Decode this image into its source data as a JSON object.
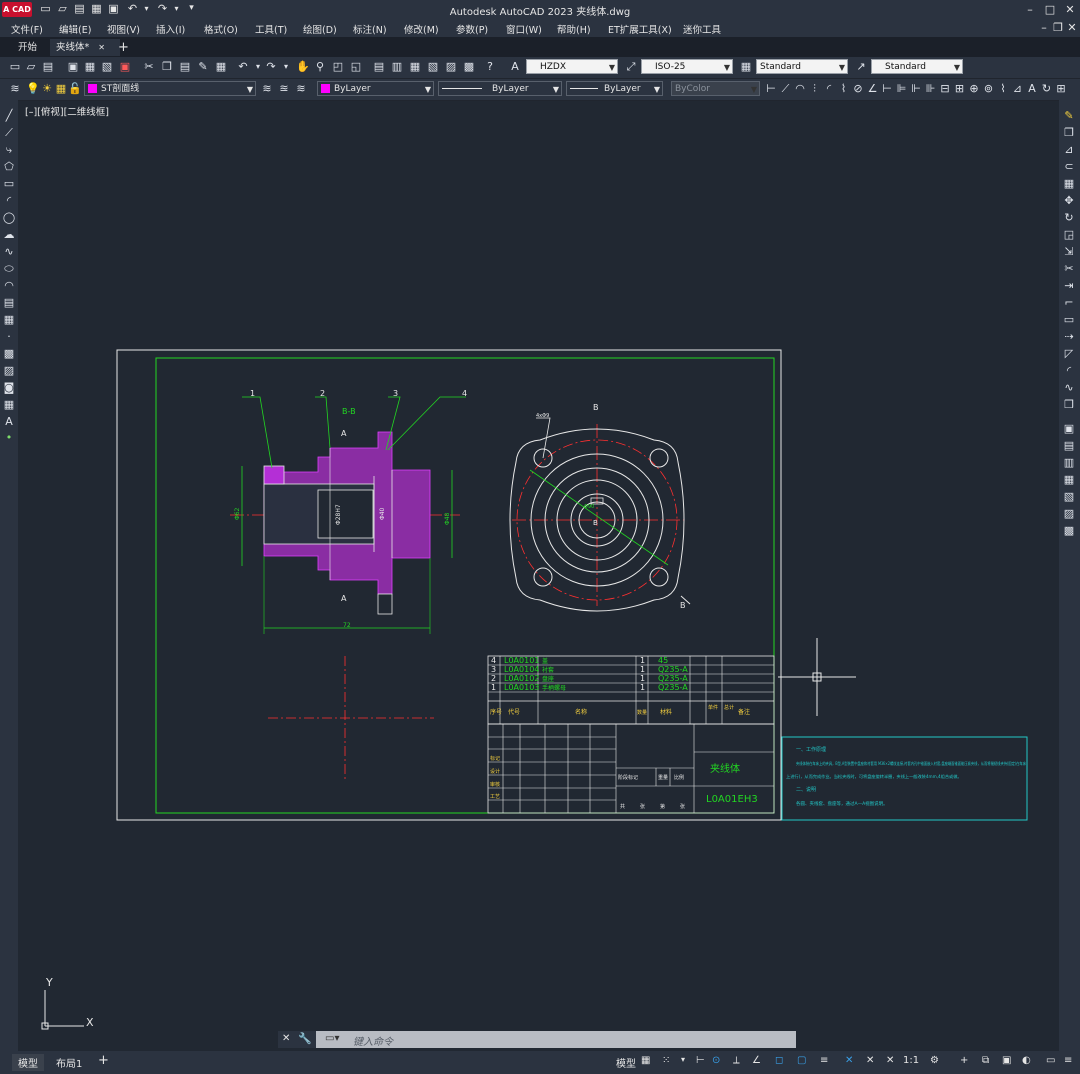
{
  "app": {
    "logo": "A CAD",
    "title": "Autodesk AutoCAD 2023    夹线体.dwg",
    "window_buttons": [
      "–",
      "□",
      "✕"
    ],
    "doc_buttons": [
      "–",
      "❐",
      "✕"
    ]
  },
  "menu": [
    "文件(F)",
    "编辑(E)",
    "视图(V)",
    "插入(I)",
    "格式(O)",
    "工具(T)",
    "绘图(D)",
    "标注(N)",
    "修改(M)",
    "参数(P)",
    "窗口(W)",
    "帮助(H)",
    "ET扩展工具(X)",
    "迷你工具"
  ],
  "tabs": [
    {
      "label": "开始"
    },
    {
      "label": "夹线体*",
      "close": "✕"
    }
  ],
  "tab_add": "+",
  "toolbar1": {
    "text_style": "HZDX",
    "dim_style": "ISO-25",
    "table_style": "Standard",
    "multileader_style": "Standard"
  },
  "toolbar2": {
    "layer": "ST剖面线",
    "color": "ByLayer",
    "linetype": "ByLayer",
    "lineweight": "ByLayer",
    "plotstyle": "ByColor",
    "colors": {
      "layer_swatch": "#ff00ff",
      "color_swatch": "#ff00ff"
    }
  },
  "view_label": "[–][俯视][二维线框]",
  "drawing": {
    "section_label": "B-B",
    "cut_mark_a": "A",
    "cut_mark_b": "B",
    "balloons": [
      "1",
      "2",
      "3",
      "4"
    ],
    "dims": {
      "d1": "Φ62",
      "d2": "Φ40",
      "d3": "Φ28H7",
      "d4": "Φ48",
      "d5": "72",
      "d6": "4xΦ9",
      "d7": "Φ90"
    },
    "parts_list": [
      {
        "no": "4",
        "code": "L0A0101",
        "name": "盖",
        "qty": "1",
        "material": "45"
      },
      {
        "no": "3",
        "code": "L0A0104",
        "name": "衬套",
        "qty": "1",
        "material": "Q235-A"
      },
      {
        "no": "2",
        "code": "L0A0102",
        "name": "盘座",
        "qty": "1",
        "material": "Q235-A"
      },
      {
        "no": "1",
        "code": "L0A0103",
        "name": "手柄螺母",
        "qty": "1",
        "material": "Q235-A"
      }
    ],
    "parts_header": {
      "no": "序号",
      "code": "代号",
      "name": "名称",
      "qty": "数量",
      "material": "材料",
      "weight": "单件",
      "total": "总计",
      "remark": "备注"
    },
    "title_block": {
      "name": "夹线体",
      "code": "L0A01EH3",
      "rows": [
        "标记",
        "设计",
        "审核",
        "工艺"
      ],
      "small": [
        "阶段标记",
        "重量",
        "比例",
        "共",
        "张",
        "第",
        "张"
      ]
    },
    "notes": [
      "一、工作原理",
      "夹线体装在车床上的夹具，B型,A型装置中盘座和衬套用 M36×2螺纹连接,衬套内孔中锥面嵌入衬套,盘座端面锥面能压紧夹线，从而将缝纫线夹持(固定)在车床",
      "上进行)，从而完成作业。当松夹线时，可将盘座旋转半圈，夹线上一般改装4mm,4组合或做。",
      "二、说明",
      "各圆、夹线套、盘座等，通过A—A视图说明。"
    ],
    "ucs": {
      "x": "X",
      "y": "Y"
    }
  },
  "command": {
    "placeholder": "键入命令"
  },
  "status": {
    "layout_tabs": [
      "模型",
      "布局1"
    ],
    "layout_add": "+",
    "model": "模型",
    "scale": "1:1"
  }
}
